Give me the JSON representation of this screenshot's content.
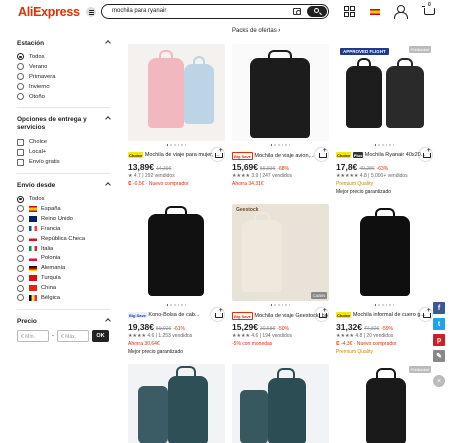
{
  "header": {
    "logo": "AliExpress",
    "search_value": "mochila para ryanair",
    "cart_count": "0"
  },
  "packs_label": "Packs de ofertas ›",
  "sidebar": {
    "season": {
      "title": "Estación",
      "options": [
        "Todos",
        "Verano",
        "Primavera",
        "Invierno",
        "Otoño"
      ],
      "selected": "Todos"
    },
    "delivery": {
      "title": "Opciones de entrega y servicios",
      "options": [
        "Choice",
        "Local+",
        "Envío gratis"
      ]
    },
    "ship_from": {
      "title": "Envío desde",
      "options": [
        "Todos",
        "España",
        "Reino Unido",
        "Francia",
        "República Checa",
        "Italia",
        "Polonia",
        "Alemania",
        "Turquía",
        "China",
        "Bélgica"
      ],
      "selected": "Todos"
    },
    "price": {
      "title": "Precio",
      "min_placeholder": "€ Mín.",
      "separator": "-",
      "max_placeholder": "€ Máx.",
      "ok_label": "OK"
    }
  },
  "products": [
    {
      "tag": "Choice",
      "tag_type": "choice",
      "title": "Mochila de viaje para mujer, ...",
      "price": "13,89€",
      "old": "14,39€",
      "disc": "",
      "rating": "★ 4.7 | 292 vendidos",
      "extra": "₡ -0,5€ · Nuevo comprador",
      "extra_type": "red",
      "extra2": ""
    },
    {
      "tag": "Big Save",
      "tag_type": "bigsave",
      "title": "Mochila de viaje avion,...",
      "price": "15,69€",
      "old": "50,83€",
      "disc": "-68%",
      "rating": "★★★★ 3.9 | 247 vendidos",
      "extra": "Ahorra 34,31€",
      "extra_type": "red",
      "extra2": ""
    },
    {
      "tag": "Choice",
      "tag_type": "choice",
      "tag2": "Plus",
      "title": "Mochila Ryanair 40x20...",
      "price": "17,8€",
      "old": "49,28€",
      "disc": "-63%",
      "rating": "★★★★★ 4.8 | 5.000+ vendidos",
      "extra": "Premium Quality",
      "extra_type": "gold",
      "extra2": "Mejor precio garantizado",
      "badge": "APPROVED FLIGHT",
      "badge_gray": "Publicidad"
    },
    {
      "tag": "Big Save",
      "tag_type": "bundle",
      "title": "Kono-Bolsa de cab...",
      "price": "19,38€",
      "old": "50,02€",
      "disc": "-61%",
      "rating": "★★★★ 4.6 | 1.253 vendidos",
      "extra": "Ahorra 30,64€",
      "extra_type": "red",
      "extra2": "Mejor precio garantizado"
    },
    {
      "tag": "Big Save",
      "tag_type": "bigsave",
      "title": "Mochila de viaje Geestock, bolsa d...",
      "price": "15,29€",
      "old": "30,58€",
      "disc": "-50%",
      "rating": "★★★★ 4.6 | 194 vendidos",
      "extra": "-5% con monedas",
      "extra_type": "red",
      "extra2": "",
      "brand": "Geestock",
      "corner": "CABIN"
    },
    {
      "tag": "Choice",
      "tag_type": "choice",
      "title": "Mochila informal de cuero g...",
      "price": "31,32€",
      "old": "77,82€",
      "disc": "-59%",
      "rating": "★★★★ 4.8 | 20 vendidos",
      "extra": "₡ -4,3€ · Nuevo comprador",
      "extra_type": "red",
      "extra2": "Premium Quality",
      "extra2_gold": true
    }
  ],
  "row3_badge": "Publicidad",
  "social": [
    "f",
    "t",
    "p",
    "✎"
  ],
  "colors": {
    "accent": "#e62e04",
    "text": "#222222",
    "facebook": "#3b5998",
    "twitter": "#1da1f2",
    "pinterest": "#cb2027",
    "edit": "#888888"
  }
}
